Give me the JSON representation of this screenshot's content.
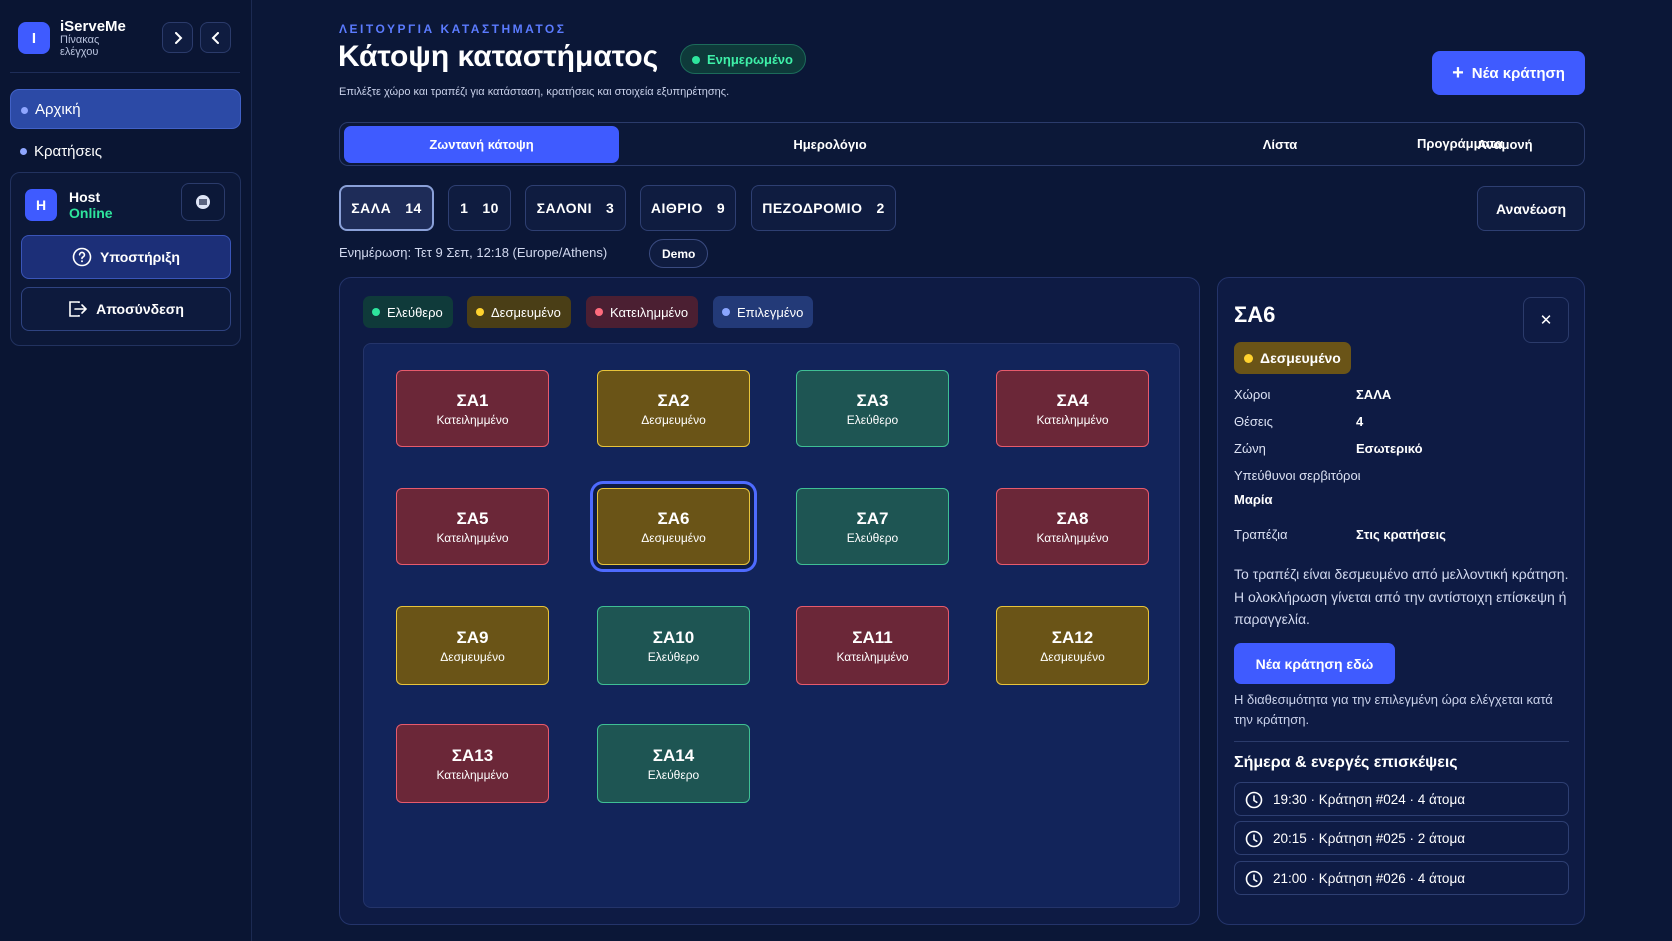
{
  "sidebar": {
    "brand_letter": "I",
    "brand_title": "iServeMe",
    "brand_subtitle": "Πίνακας ελέγχου",
    "nav": [
      {
        "label": "Αρχική",
        "active": true
      },
      {
        "label": "Κρατήσεις",
        "active": false
      }
    ],
    "host": {
      "initial": "H",
      "name": "Host",
      "status": "Online"
    },
    "support_label": "Υποστήριξη",
    "logout_label": "Αποσύνδεση"
  },
  "header": {
    "eyebrow": "ΛΕΙΤΟΥΡΓΙΑ ΚΑΤΑΣΤΗΜΑΤΟΣ",
    "title": "Κάτοψη καταστήματος",
    "status_pill": "Ενημερωμένο",
    "subtitle": "Επιλέξτε χώρο και τραπέζι για κατάσταση, κρατήσεις και στοιχεία εξυπηρέτησης.",
    "primary_action": "Νέα κράτηση"
  },
  "tabs": [
    {
      "label": "Ζωντανή κάτοψη",
      "active": true
    },
    {
      "label": "Ημερολόγιο",
      "active": false
    },
    {
      "label": "Λίστα",
      "active": false
    },
    {
      "label": "Αναμονή",
      "active": false
    },
    {
      "label": "Προγράμματα",
      "active": false
    }
  ],
  "rooms": [
    {
      "name": "ΣΑΛΑ",
      "count": "14",
      "active": true
    },
    {
      "name": "1",
      "count": "10",
      "active": false
    },
    {
      "name": "ΣΑΛΟΝΙ",
      "count": "3",
      "active": false
    },
    {
      "name": "ΑΙΘΡΙΟ",
      "count": "9",
      "active": false
    },
    {
      "name": "ΠΕΖΟΔΡΟΜΙΟ",
      "count": "2",
      "active": false
    }
  ],
  "refresh_label": "Ανανέωση",
  "updated_text": "Ενημέρωση: Τετ 9 Σεπ, 12:18 (Europe/Athens)",
  "demo_label": "Demo",
  "legend": [
    {
      "label": "Ελεύθερο",
      "color": "#2ee59d",
      "bg": "#0f3a3a"
    },
    {
      "label": "Δεσμευμένο",
      "color": "#ffd22e",
      "bg": "#4a3e16"
    },
    {
      "label": "Κατειλημμένο",
      "color": "#ff6b7d",
      "bg": "#4b1f32"
    },
    {
      "label": "Επιλεγμένο",
      "color": "#8aa6ff",
      "bg": "#233a78"
    }
  ],
  "tables": [
    {
      "name": "ΣΑ1",
      "status": "Κατειλημμένο"
    },
    {
      "name": "ΣΑ2",
      "status": "Δεσμευμένο"
    },
    {
      "name": "ΣΑ3",
      "status": "Ελεύθερο"
    },
    {
      "name": "ΣΑ4",
      "status": "Κατειλημμένο"
    },
    {
      "name": "ΣΑ5",
      "status": "Κατειλημμένο"
    },
    {
      "name": "ΣΑ6",
      "status": "Δεσμευμένο"
    },
    {
      "name": "ΣΑ7",
      "status": "Ελεύθερο"
    },
    {
      "name": "ΣΑ8",
      "status": "Κατειλημμένο"
    },
    {
      "name": "ΣΑ9",
      "status": "Δεσμευμένο"
    },
    {
      "name": "ΣΑ10",
      "status": "Ελεύθερο"
    },
    {
      "name": "ΣΑ11",
      "status": "Κατειλημμένο"
    },
    {
      "name": "ΣΑ12",
      "status": "Δεσμευμένο"
    },
    {
      "name": "ΣΑ13",
      "status": "Κατειλημμένο"
    },
    {
      "name": "ΣΑ14",
      "status": "Ελεύθερο"
    }
  ],
  "selected_table": "ΣΑ6",
  "detail": {
    "title": "ΣΑ6",
    "badge": "Δεσμευμένο",
    "rows": [
      {
        "label": "Χώροι",
        "value": "ΣΑΛΑ"
      },
      {
        "label": "Θέσεις",
        "value": "4"
      },
      {
        "label": "Ζώνη",
        "value": "Εσωτερικό"
      }
    ],
    "waiters_label": "Υπεύθυνοι σερβιτόροι",
    "waiters_value": "Μαρία",
    "tables_label": "Τραπέζια",
    "tables_value": "Στις κρατήσεις",
    "description": "Το τραπέζι είναι δεσμευμένο από μελλοντική κράτηση. Η ολοκλήρωση γίνεται από την αντίστοιχη επίσκεψη ή παραγγελία.",
    "action": "Νέα κράτηση εδώ",
    "note": "Η διαθεσιμότητα για την επιλεγμένη ώρα ελέγχεται κατά την κράτηση.",
    "visits_title": "Σήμερα & ενεργές επισκέψεις",
    "visits": [
      "19:30 · Κράτηση #024 · 4 άτομα",
      "20:15 · Κράτηση #025 · 2 άτομα",
      "21:00 · Κράτηση #026 · 4 άτομα"
    ]
  }
}
